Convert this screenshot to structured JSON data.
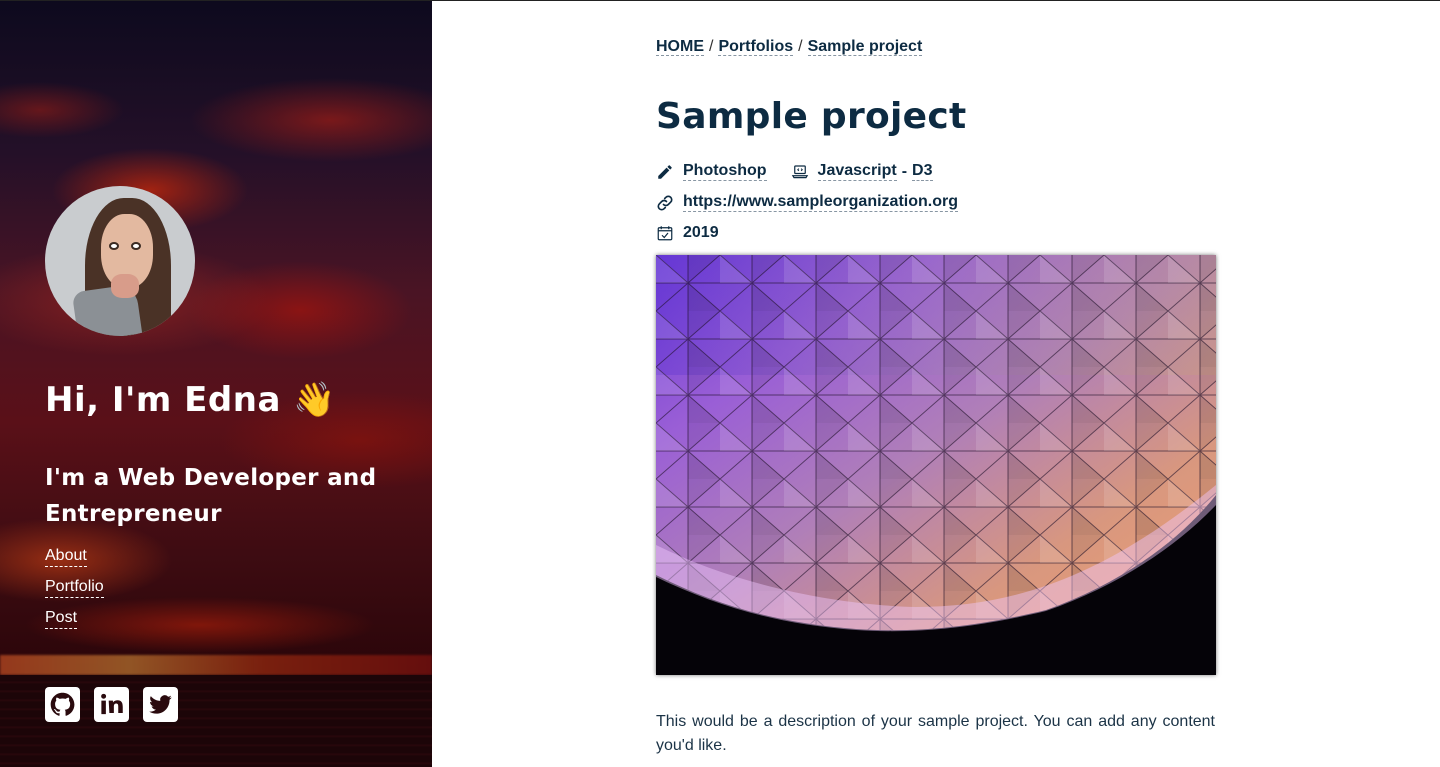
{
  "sidebar": {
    "avatar_alt": "profile photo",
    "greeting": "Hi, I'm Edna 👋",
    "tagline": "I'm a Web Developer and Entrepreneur",
    "nav": [
      {
        "label": "About"
      },
      {
        "label": "Portfolio"
      },
      {
        "label": "Post"
      }
    ],
    "socials": [
      {
        "name": "github-icon",
        "label": "GitHub"
      },
      {
        "name": "linkedin-icon",
        "label": "LinkedIn"
      },
      {
        "name": "twitter-icon",
        "label": "Twitter"
      }
    ]
  },
  "breadcrumb": {
    "home": "HOME",
    "sep": "/",
    "portfolios": "Portfolios",
    "current": "Sample project"
  },
  "project": {
    "title": "Sample project",
    "tools": [
      "Photoshop"
    ],
    "tech_part1": "Javascript",
    "tech_dash": "-",
    "tech_part2": "D3",
    "url": "https://www.sampleorganization.org",
    "year": "2019",
    "image_alt": "illuminated geodesic dome at night",
    "description": "This would be a description of your sample project. You can add any content you'd like."
  },
  "colors": {
    "text": "#0d2b42",
    "sidebar_text": "#ffffff"
  }
}
